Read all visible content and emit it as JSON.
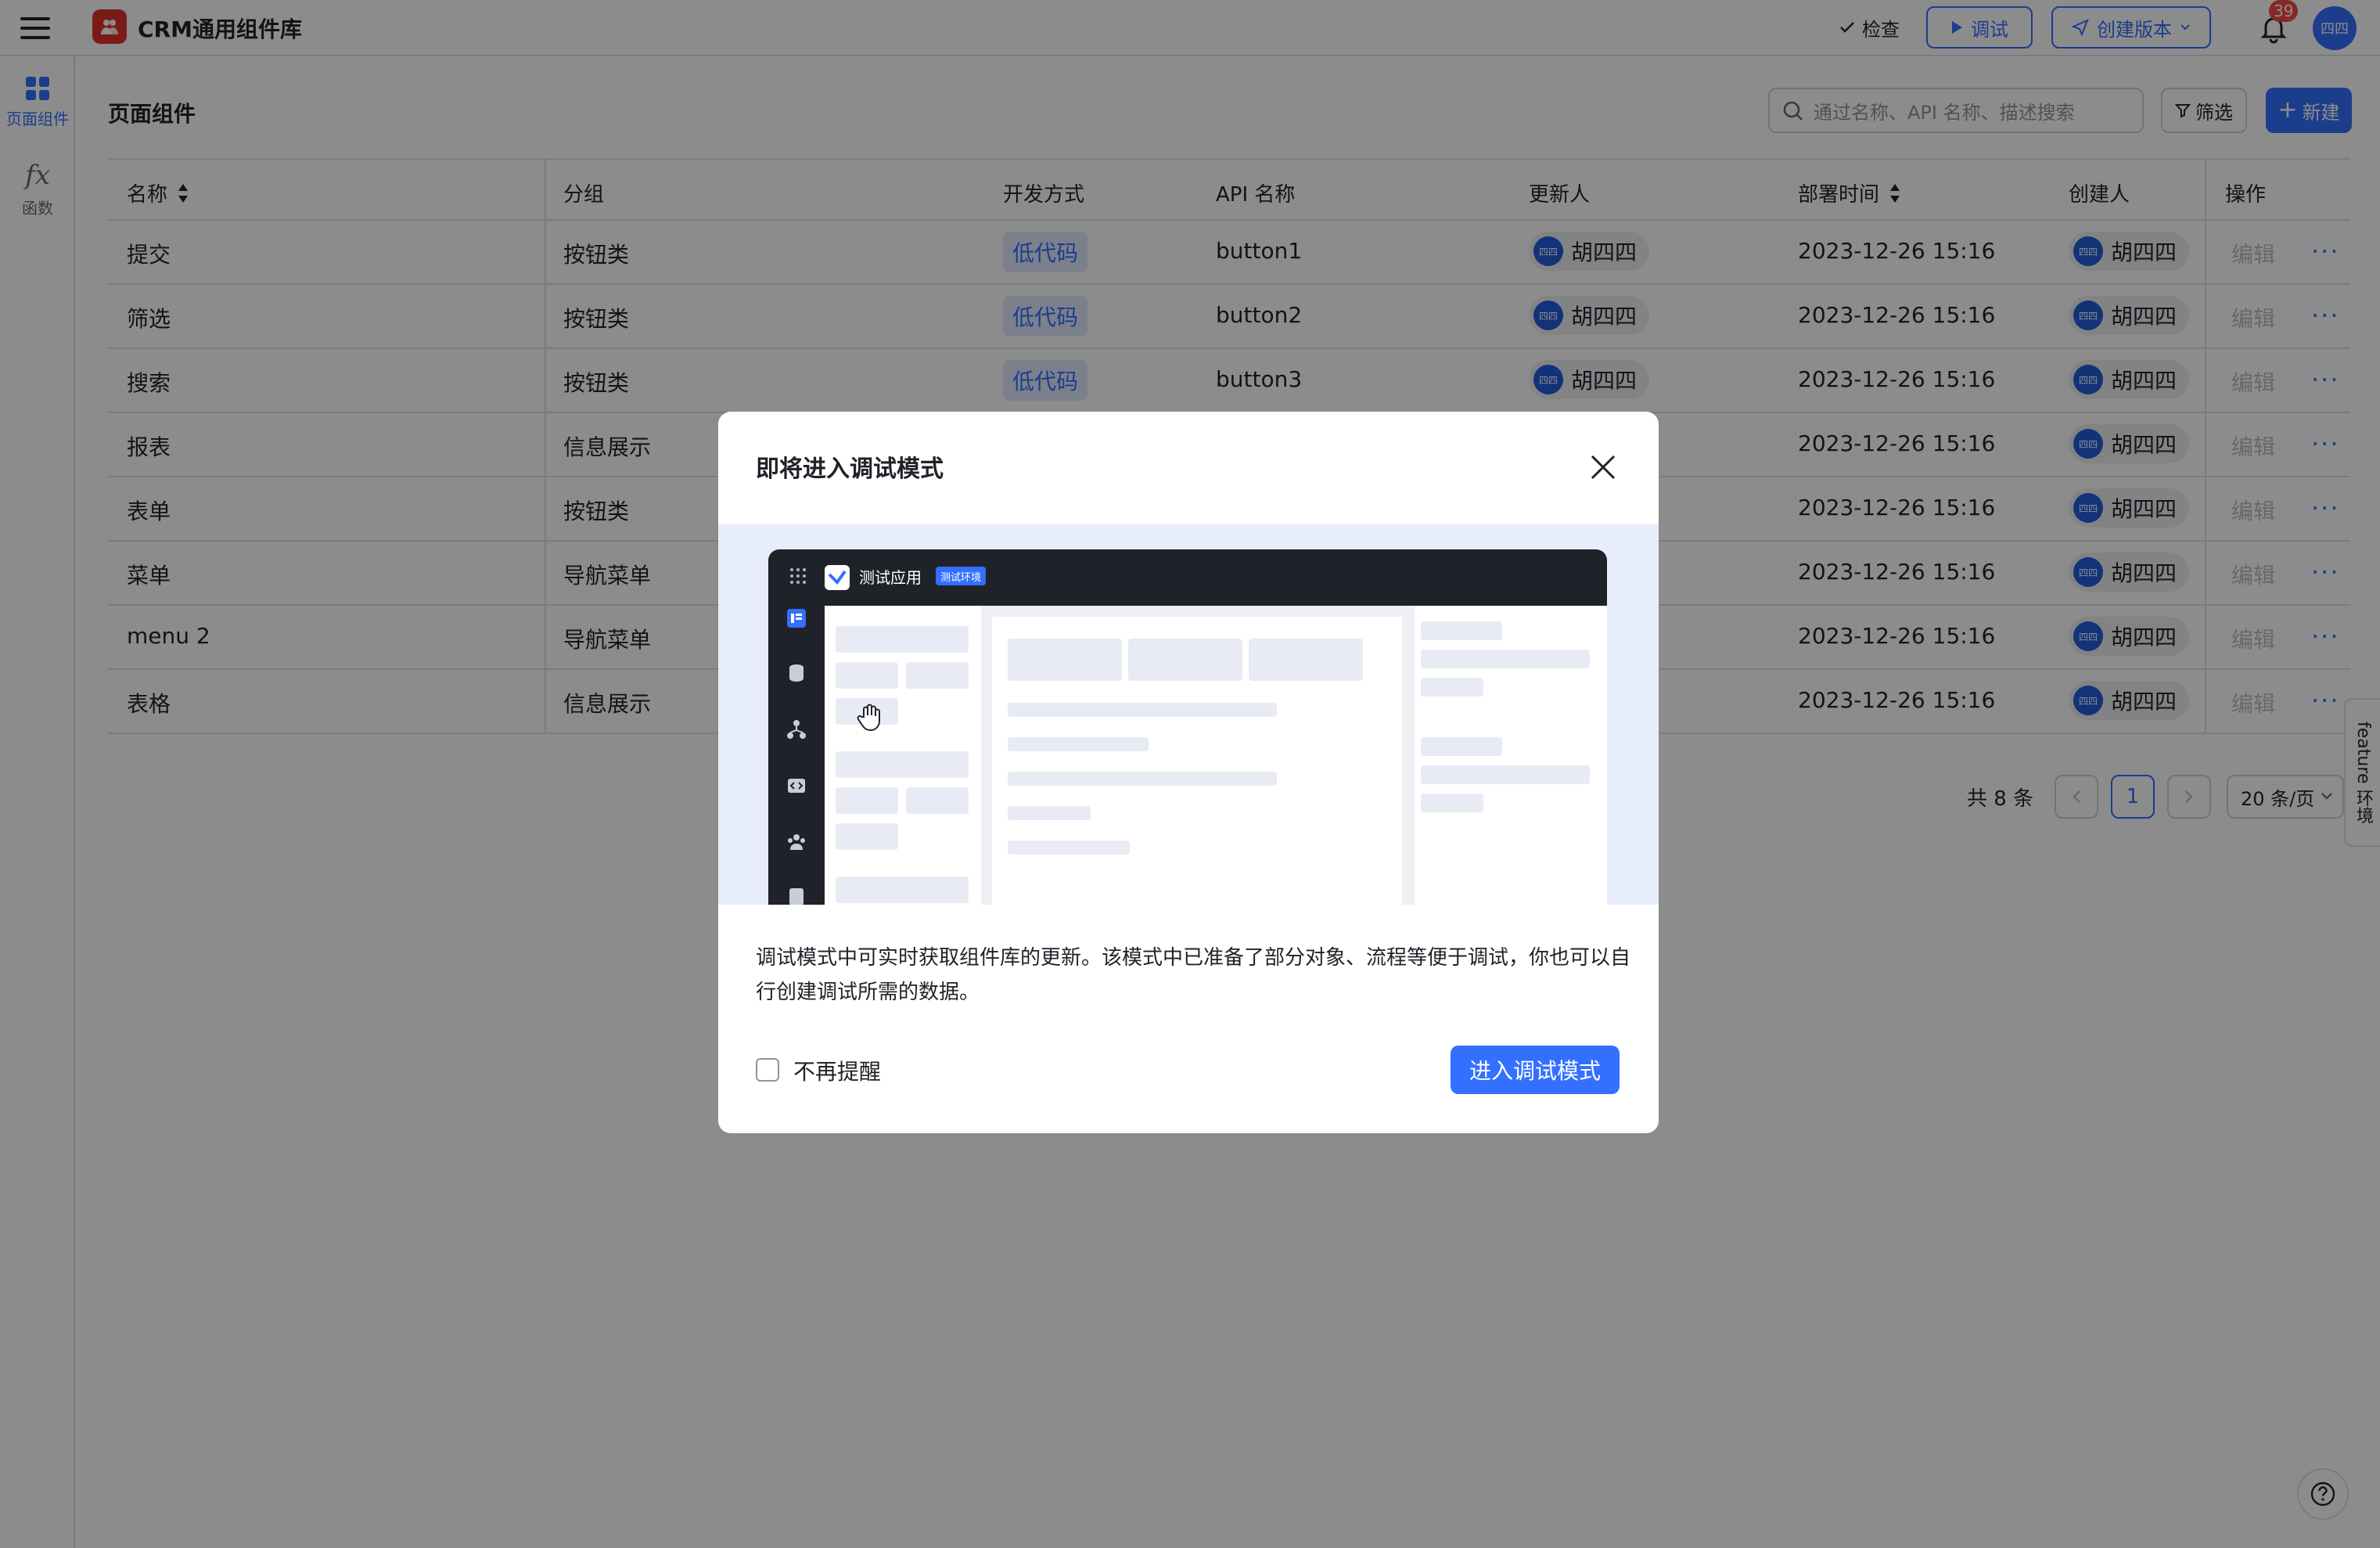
{
  "app": {
    "title": "CRM通用组件库",
    "check_label": "检查",
    "debug_label": "调试",
    "create_version_label": "创建版本",
    "notification_count": "39",
    "avatar_text": "四四"
  },
  "rail": {
    "items": [
      {
        "label": "页面组件",
        "icon": "grid-icon"
      },
      {
        "label": "函数",
        "icon": "fx-icon"
      }
    ]
  },
  "main": {
    "page_title": "页面组件",
    "search_placeholder": "通过名称、API 名称、描述搜索",
    "filter_label": "筛选",
    "new_label": "新建",
    "columns": [
      "名称",
      "分组",
      "开发方式",
      "API 名称",
      "更新人",
      "部署时间",
      "创建人",
      "操作"
    ],
    "rows": [
      {
        "name": "提交",
        "group": "按钮类",
        "dev": "低代码",
        "api": "button1",
        "updater": "胡四四",
        "time": "2023-12-26 15:16",
        "creator": "胡四四",
        "edit": "编辑"
      },
      {
        "name": "筛选",
        "group": "按钮类",
        "dev": "低代码",
        "api": "button2",
        "updater": "胡四四",
        "time": "2023-12-26 15:16",
        "creator": "胡四四",
        "edit": "编辑"
      },
      {
        "name": "搜索",
        "group": "按钮类",
        "dev": "低代码",
        "api": "button3",
        "updater": "胡四四",
        "time": "2023-12-26 15:16",
        "creator": "胡四四",
        "edit": "编辑"
      },
      {
        "name": "报表",
        "group": "信息展示",
        "dev": "",
        "api": "",
        "updater": "",
        "time": "2023-12-26 15:16",
        "creator": "胡四四",
        "edit": "编辑"
      },
      {
        "name": "表单",
        "group": "按钮类",
        "dev": "",
        "api": "",
        "updater": "",
        "time": "2023-12-26 15:16",
        "creator": "胡四四",
        "edit": "编辑"
      },
      {
        "name": "菜单",
        "group": "导航菜单",
        "dev": "",
        "api": "",
        "updater": "",
        "time": "2023-12-26 15:16",
        "creator": "胡四四",
        "edit": "编辑"
      },
      {
        "name": "menu 2",
        "group": "导航菜单",
        "dev": "",
        "api": "",
        "updater": "",
        "time": "2023-12-26 15:16",
        "creator": "胡四四",
        "edit": "编辑"
      },
      {
        "name": "表格",
        "group": "信息展示",
        "dev": "",
        "api": "",
        "updater": "",
        "time": "2023-12-26 15:16",
        "creator": "胡四四",
        "edit": "编辑"
      }
    ],
    "total_text": "共 8 条",
    "current_page": "1",
    "page_size": "20 条/页",
    "mini_avatar_text": "四四"
  },
  "feature_tab": "feature 环境",
  "modal": {
    "title": "即将进入调试模式",
    "mock_app_name": "测试应用",
    "mock_env_tag": "测试环境",
    "description": "调试模式中可实时获取组件库的更新。该模式中已准备了部分对象、流程等便于调试，你也可以自行创建调试所需的数据。",
    "checkbox_label": "不再提醒",
    "enter_button": "进入调试模式"
  },
  "colors": {
    "primary": "#3370ff",
    "danger": "#f54a45",
    "brand_logo": "#e0322b"
  }
}
